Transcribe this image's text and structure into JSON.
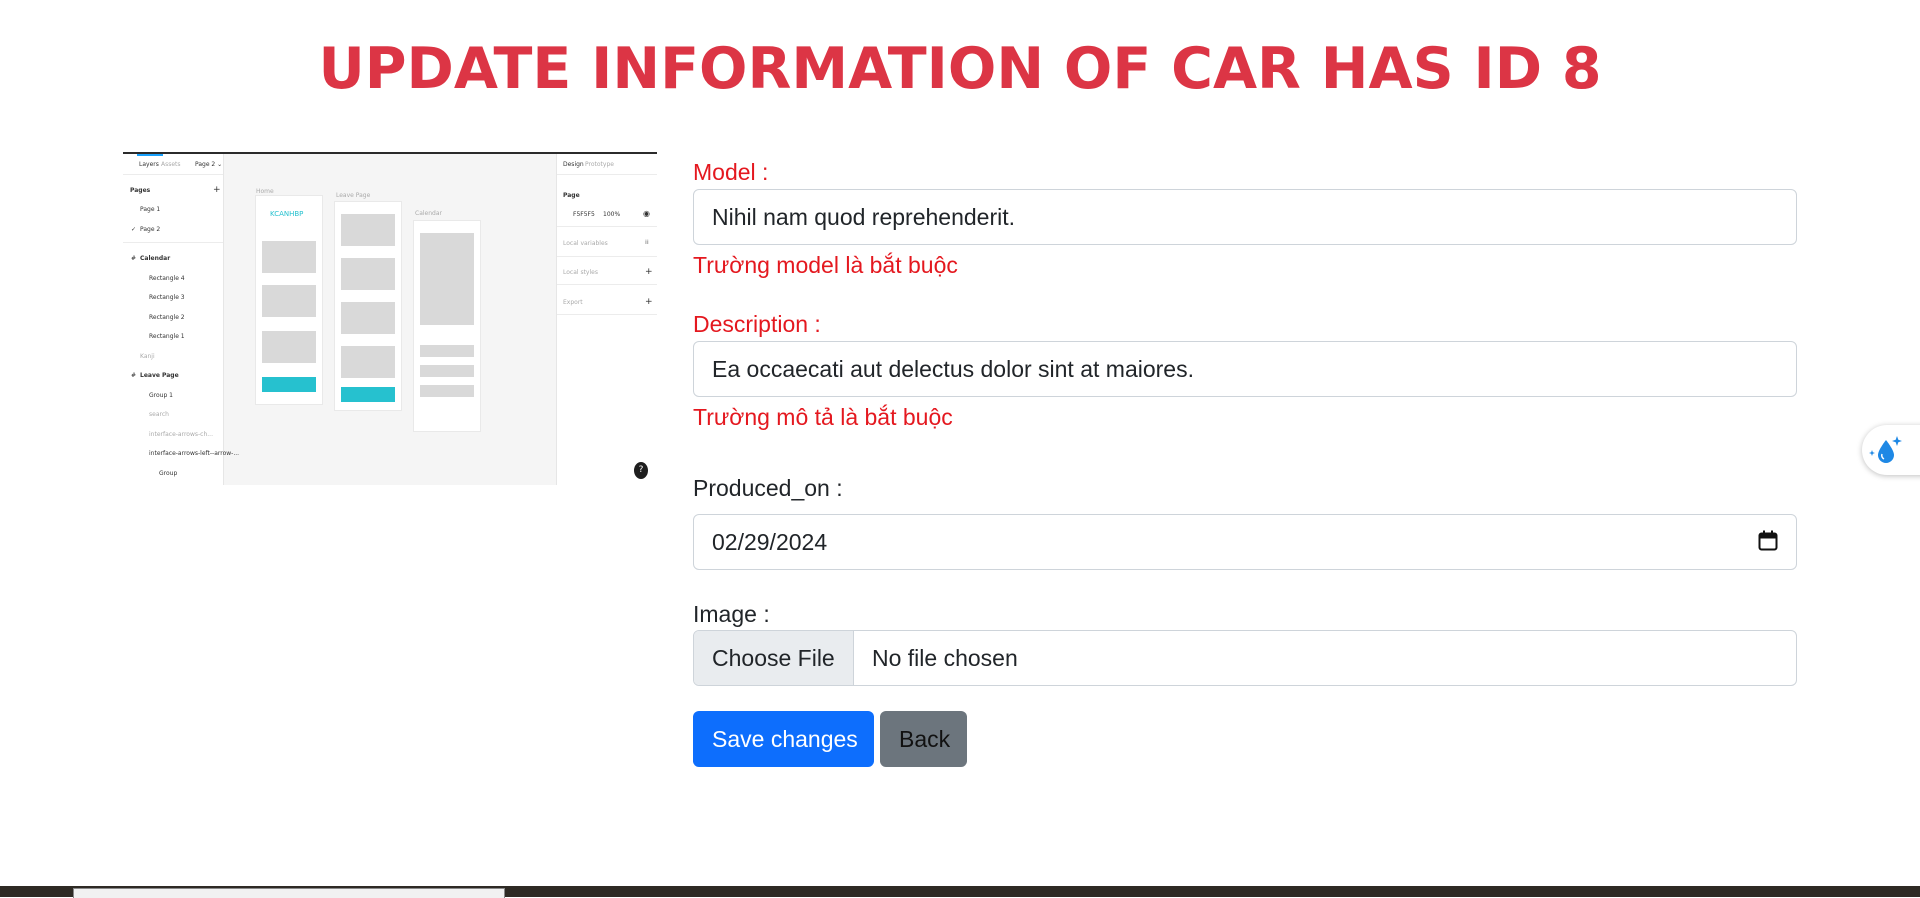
{
  "page": {
    "title": "UPDATE INFORMATION OF CAR HAS ID 8"
  },
  "preview": {
    "tabs": [
      "Layers",
      "Assets",
      "Page 2 ⌄"
    ],
    "right_tabs": [
      "Design",
      "Prototype"
    ],
    "pages_label": "Pages",
    "pages": [
      "Page 1",
      "Page 2"
    ],
    "layers": [
      "Calendar",
      "Rectangle 4",
      "Rectangle 3",
      "Rectangle 2",
      "Rectangle 1",
      "Kanji",
      "Leave Page",
      "Group 1",
      "search",
      "interface-arrows-ch...",
      "interface-arrows-left--arrow-...",
      "Group"
    ],
    "frame_labels": [
      "Home",
      "Leave Page",
      "Calendar"
    ],
    "frame_brand": "KCANHBP",
    "right_items": [
      "Page",
      "F5F5F5",
      "100%",
      "Local variables",
      "Local styles",
      "Export"
    ],
    "help_glyph": "?"
  },
  "form": {
    "model": {
      "label": "Model :",
      "value": "Nihil nam quod reprehenderit.",
      "error": "Trường model là bắt buộc"
    },
    "description": {
      "label": "Description :",
      "value": "Ea occaecati aut delectus dolor sint at maiores.",
      "error": "Trường mô tả là bắt buộc"
    },
    "produced_on": {
      "label": "Produced_on :",
      "value": "02/29/2024"
    },
    "image": {
      "label": "Image :",
      "button": "Choose File",
      "status": "No file chosen"
    },
    "actions": {
      "save": "Save changes",
      "back": "Back"
    }
  },
  "colors": {
    "title": "#dc3545",
    "error": "#e4181f",
    "primary": "#0d6efd",
    "secondary": "#6c757d"
  },
  "icons": {
    "calendar": "calendar-icon",
    "widget": "water-drop-sparkle-icon"
  }
}
